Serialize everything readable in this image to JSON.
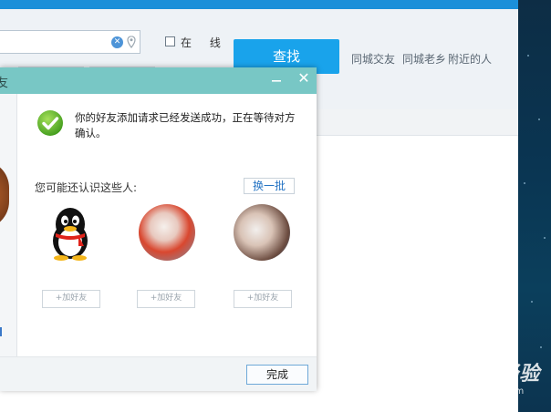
{
  "main": {
    "online_label": "在 线",
    "find_label": "查找",
    "quick_links": [
      "同城交友",
      "同城老乡",
      "附近的人"
    ],
    "clear_icon": "clear-icon",
    "location_icon": "location-pin-icon"
  },
  "dialog": {
    "title": "友",
    "minimize_icon": "minimize-icon",
    "close_icon": "close-icon",
    "status_icon": "check-circle-icon",
    "message": "你的好友添加请求已经发送成功，正在等待对方确认。",
    "maybe_know_label": "您可能还认识这些人:",
    "swap_label": "换一批",
    "done_label": "完成",
    "accent_color": "#78c7c5",
    "people": [
      {
        "avatar": "qq-penguin-avatar",
        "add_label": "+加好友"
      },
      {
        "avatar": "photo-avatar",
        "add_label": "+加好友"
      },
      {
        "avatar": "photo-avatar",
        "add_label": "+加好友"
      }
    ]
  },
  "watermark": {
    "brand": "Baidu 经验",
    "url": "jingyan.baidu.com"
  },
  "colors": {
    "top_bar": "#1b8fd9",
    "find_button": "#19a3eb",
    "link_blue": "#2574c4"
  }
}
